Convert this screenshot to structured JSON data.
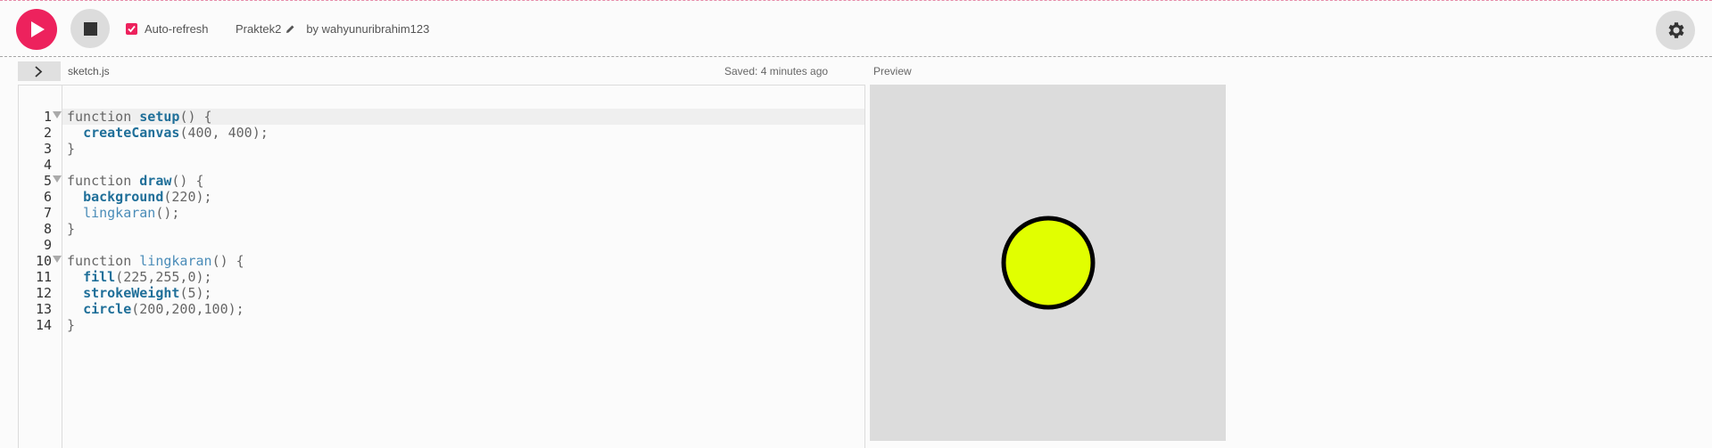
{
  "toolbar": {
    "auto_refresh_label": "Auto-refresh",
    "auto_refresh_checked": true,
    "project_name": "Praktek2",
    "author": "by wahyunuribrahim123"
  },
  "editor": {
    "filename": "sketch.js",
    "saved_status": "Saved: 4 minutes ago",
    "lines": [
      {
        "n": "1",
        "fold": true,
        "parts": [
          [
            "kw",
            "function "
          ],
          [
            "fn",
            "setup"
          ],
          [
            "p",
            "() {"
          ]
        ]
      },
      {
        "n": "2",
        "fold": false,
        "parts": [
          [
            "p",
            "  "
          ],
          [
            "fn",
            "createCanvas"
          ],
          [
            "p",
            "(400, 400);"
          ]
        ]
      },
      {
        "n": "3",
        "fold": false,
        "parts": [
          [
            "p",
            "}"
          ]
        ]
      },
      {
        "n": "4",
        "fold": false,
        "parts": []
      },
      {
        "n": "5",
        "fold": true,
        "parts": [
          [
            "kw",
            "function "
          ],
          [
            "fn",
            "draw"
          ],
          [
            "p",
            "() {"
          ]
        ]
      },
      {
        "n": "6",
        "fold": false,
        "parts": [
          [
            "p",
            "  "
          ],
          [
            "fn",
            "background"
          ],
          [
            "p",
            "(220);"
          ]
        ]
      },
      {
        "n": "7",
        "fold": false,
        "parts": [
          [
            "p",
            "  "
          ],
          [
            "call",
            "lingkaran"
          ],
          [
            "p",
            "();"
          ]
        ]
      },
      {
        "n": "8",
        "fold": false,
        "parts": [
          [
            "p",
            "}"
          ]
        ]
      },
      {
        "n": "9",
        "fold": false,
        "parts": []
      },
      {
        "n": "10",
        "fold": true,
        "parts": [
          [
            "kw",
            "function "
          ],
          [
            "call",
            "lingkaran"
          ],
          [
            "p",
            "() {"
          ]
        ]
      },
      {
        "n": "11",
        "fold": false,
        "parts": [
          [
            "p",
            "  "
          ],
          [
            "fn",
            "fill"
          ],
          [
            "p",
            "(225,255,0);"
          ]
        ]
      },
      {
        "n": "12",
        "fold": false,
        "parts": [
          [
            "p",
            "  "
          ],
          [
            "fn",
            "strokeWeight"
          ],
          [
            "p",
            "(5);"
          ]
        ]
      },
      {
        "n": "13",
        "fold": false,
        "parts": [
          [
            "p",
            "  "
          ],
          [
            "fn",
            "circle"
          ],
          [
            "p",
            "(200,200,100);"
          ]
        ]
      },
      {
        "n": "14",
        "fold": false,
        "parts": [
          [
            "p",
            "}"
          ]
        ]
      }
    ]
  },
  "preview": {
    "label": "Preview",
    "canvas_background": "#dcdcdc",
    "circle_fill": "#e1ff00",
    "circle_stroke": "#000000"
  },
  "colors": {
    "accent": "#ed225d"
  }
}
